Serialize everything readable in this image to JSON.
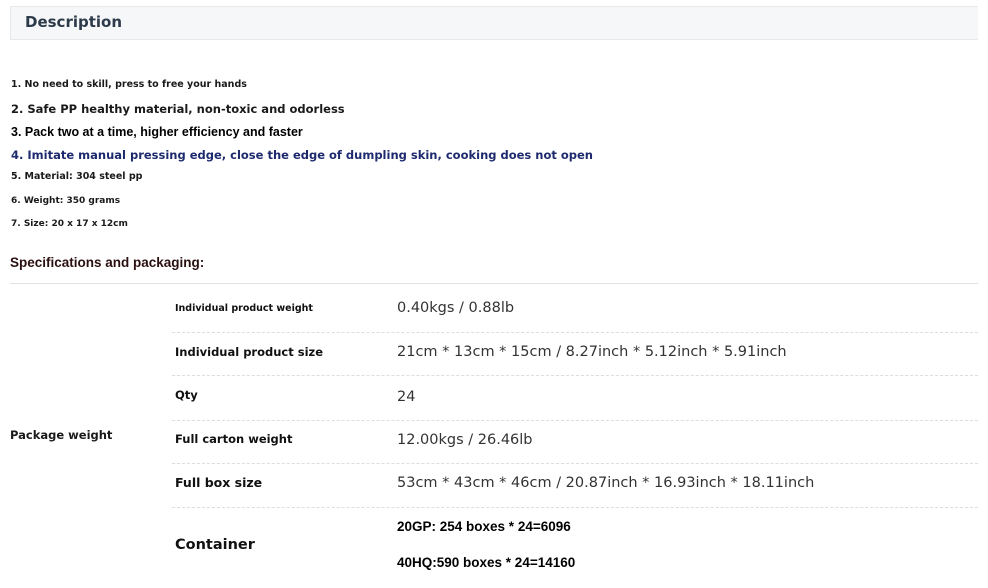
{
  "description": {
    "title": "Description",
    "features": [
      "1. No need to skill, press to free your hands",
      "2. Safe PP healthy material, non-toxic and odorless",
      "3. Pack two at a time, higher efficiency and faster",
      "4. Imitate manual pressing edge, close the edge of dumpling skin, cooking does not open",
      "5. Material: 304 steel pp",
      "6. Weight: 350 grams",
      "7. Size: 20 x 17 x 12cm"
    ]
  },
  "specifications": {
    "title": "Specifications and packaging:",
    "group_label": "Package weight",
    "rows": [
      {
        "label": "Individual product weight",
        "value": "0.40kgs / 0.88lb"
      },
      {
        "label": "Individual product size",
        "value": "21cm * 13cm * 15cm / 8.27inch * 5.12inch * 5.91inch"
      },
      {
        "label": "Qty",
        "value": "24"
      },
      {
        "label": "Full carton weight",
        "value": "12.00kgs / 26.46lb"
      },
      {
        "label": "Full box size",
        "value": "53cm * 43cm * 46cm / 20.87inch * 16.93inch * 18.11inch"
      }
    ],
    "container": {
      "label": "Container",
      "values": [
        "20GP: 254 boxes * 24=6096",
        "40HQ:590 boxes * 24=14160"
      ]
    }
  }
}
